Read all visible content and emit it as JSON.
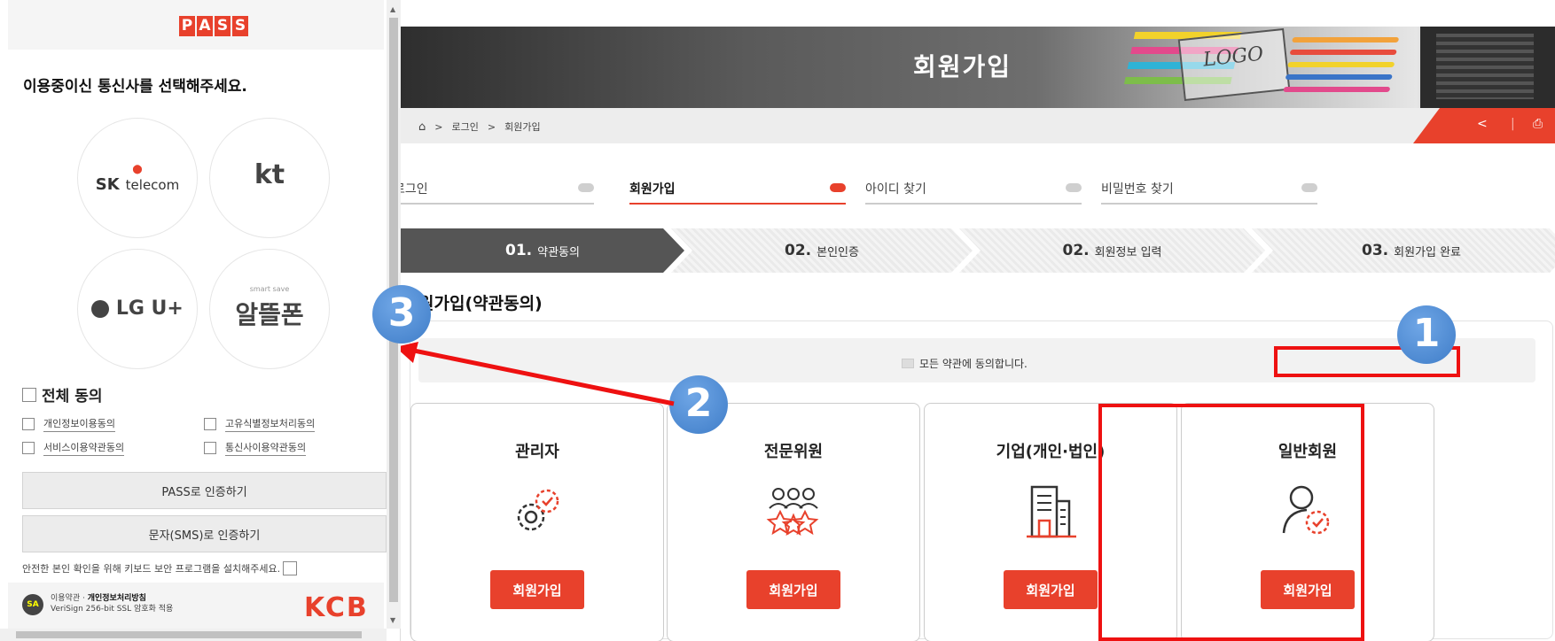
{
  "popup": {
    "logo_letters": [
      "P",
      "A",
      "S",
      "S"
    ],
    "question": "이용중이신 통신사를 선택해주세요.",
    "carriers": [
      {
        "name": "SK telecom"
      },
      {
        "name": "kt"
      },
      {
        "name": "LG U+"
      },
      {
        "name": "알뜰폰",
        "sub": "smart save"
      }
    ],
    "all_agree": "전체 동의",
    "agree_items": [
      "개인정보이용동의",
      "고유식별정보처리동의",
      "서비스이용약관동의",
      "통신사이용약관동의"
    ],
    "pass_button": "PASS로 인증하기",
    "sms_button": "문자(SMS)로 인증하기",
    "security_note": "안전한 본인 확인을 위해 키보드 보안 프로그램을 설치해주세요.",
    "footer": {
      "badge": "SA",
      "terms": "이용약관",
      "privacy": "개인정보처리방침",
      "ssl": "VeriSign 256-bit SSL 암호화 적용",
      "brand": "KCB"
    }
  },
  "page": {
    "hero_title": "회원가입",
    "hero_logo": "LOGO",
    "breadcrumb": [
      "로그인",
      "회원가입"
    ],
    "tabs": [
      "로그인",
      "회원가입",
      "아이디 찾기",
      "비밀번호 찾기"
    ],
    "active_tab": "회원가입",
    "steps": [
      {
        "num": "01.",
        "label": "약관동의"
      },
      {
        "num": "02.",
        "label": "본인인증"
      },
      {
        "num": "02.",
        "label": "회원정보 입력"
      },
      {
        "num": "03.",
        "label": "회원가입 완료"
      }
    ],
    "section_title": "원가입(약관동의)",
    "agree_all": "모든 약관에 동의합니다.",
    "member_types": [
      {
        "title": "관리자",
        "icon": "gear-check-icon",
        "button": "회원가입"
      },
      {
        "title": "전문위원",
        "icon": "team-stars-icon",
        "button": "회원가입"
      },
      {
        "title": "기업(개인·법인)",
        "icon": "building-icon",
        "button": "회원가입"
      },
      {
        "title": "일반회원",
        "icon": "user-gear-icon",
        "button": "회원가입"
      }
    ]
  },
  "annotations": {
    "badges": [
      "1",
      "2",
      "3"
    ],
    "highlight_color": "#ee1111",
    "badge_color": "#4a86d0"
  },
  "colors": {
    "accent": "#e8412c",
    "step_active": "#555555"
  }
}
